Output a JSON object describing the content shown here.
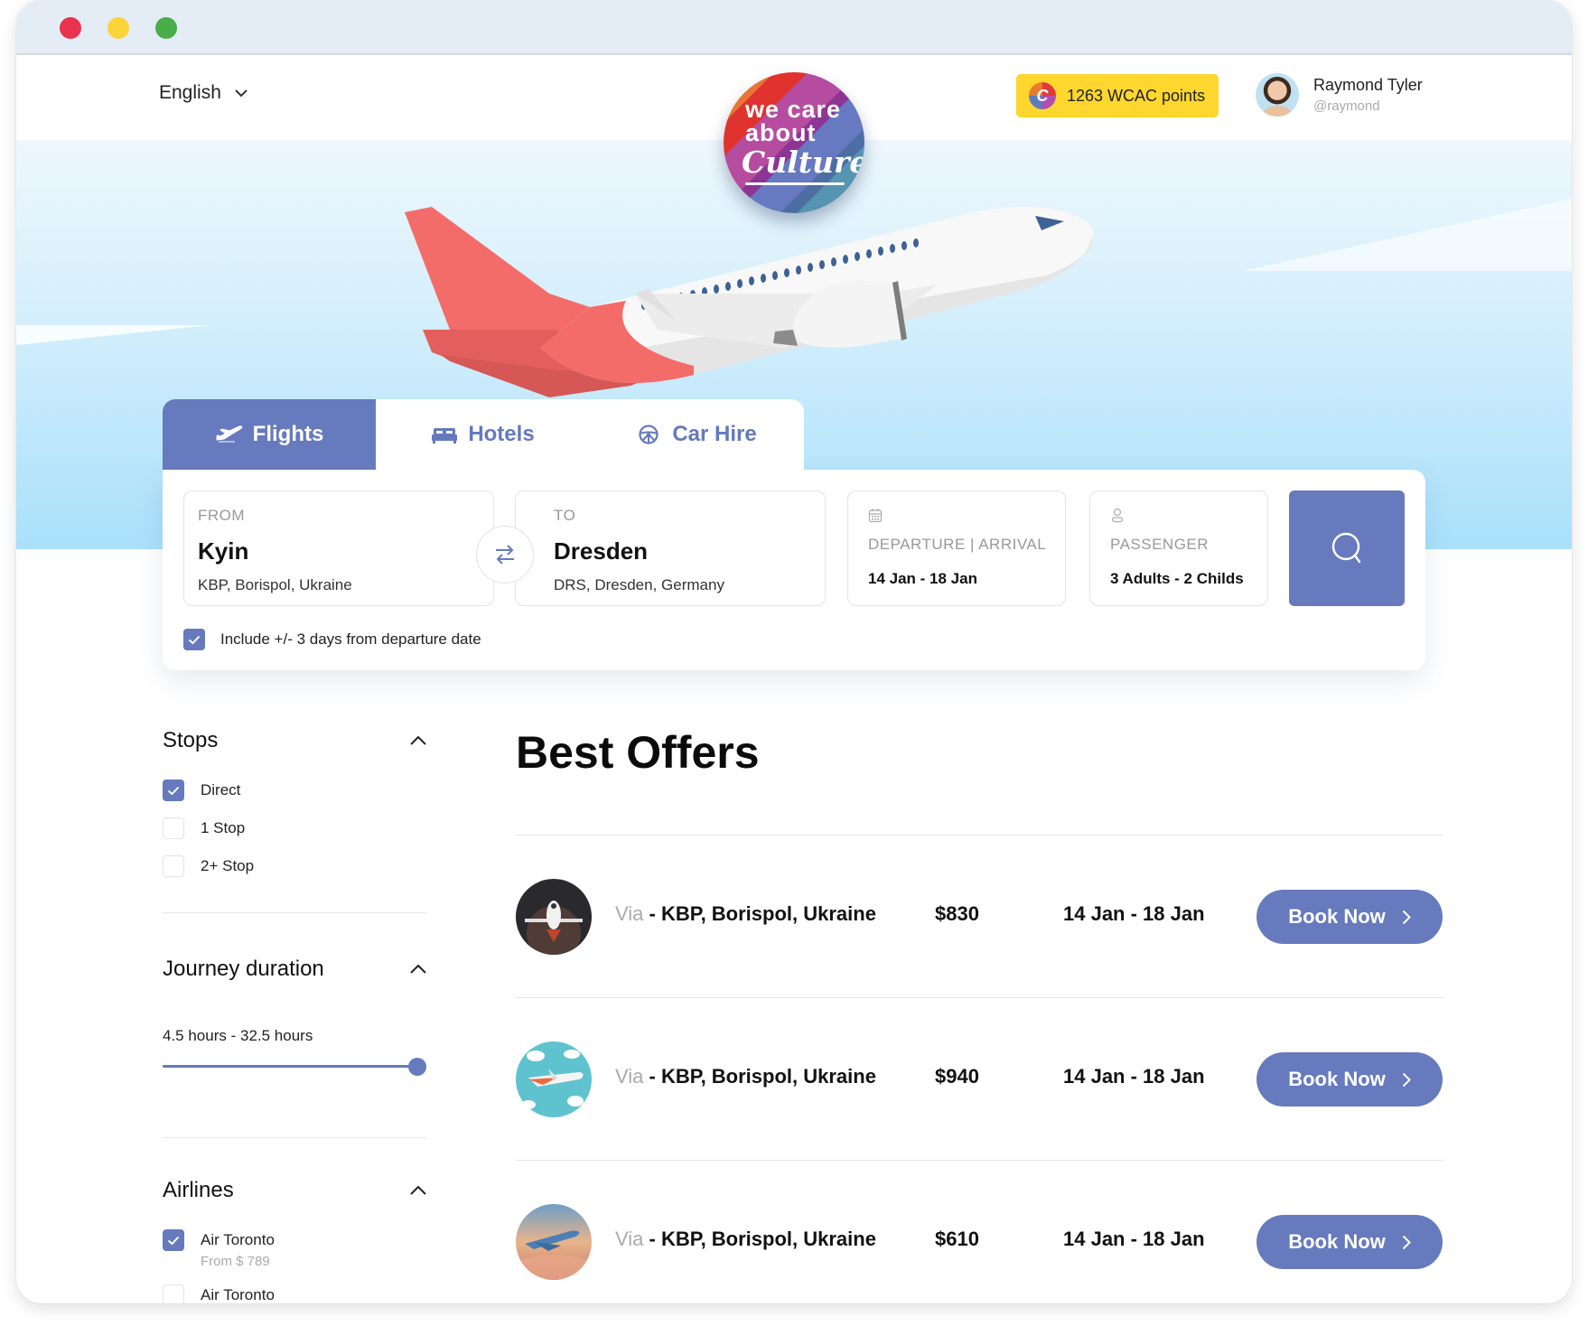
{
  "window": {
    "controls": [
      "close",
      "minimize",
      "maximize"
    ]
  },
  "header": {
    "language": "English",
    "points_label": "1263 WCAC points",
    "points_icon_letter": "C",
    "user": {
      "name": "Raymond Tyler",
      "handle": "@raymond"
    }
  },
  "logo": {
    "line1": "we care",
    "line2": "about",
    "line3": "Culture"
  },
  "tabs": [
    {
      "label": "Flights",
      "icon": "plane-icon",
      "active": true
    },
    {
      "label": "Hotels",
      "icon": "bed-icon",
      "active": false
    },
    {
      "label": "Car Hire",
      "icon": "steering-wheel-icon",
      "active": false
    }
  ],
  "search": {
    "from": {
      "label": "FROM",
      "city": "Kyin",
      "detail": "KBP, Borispol, Ukraine"
    },
    "to": {
      "label": "TO",
      "city": "Dresden",
      "detail": "DRS, Dresden, Germany"
    },
    "dates": {
      "label": "DEPARTURE  |  ARRIVAL",
      "value": "14 Jan  -  18 Jan"
    },
    "passenger": {
      "label": "PASSENGER",
      "value": "3 Adults - 2 Childs"
    },
    "include_flex": {
      "label": "Include +/- 3 days from departure date",
      "checked": true
    }
  },
  "filters": {
    "stops": {
      "title": "Stops",
      "options": [
        {
          "label": "Direct",
          "checked": true
        },
        {
          "label": "1 Stop",
          "checked": false
        },
        {
          "label": "2+ Stop",
          "checked": false
        }
      ]
    },
    "duration": {
      "title": "Journey duration",
      "range_label": "4.5 hours - 32.5 hours",
      "min_hours": 4.5,
      "max_hours": 32.5,
      "slider_fraction": 1.0
    },
    "airlines": {
      "title": "Airlines",
      "options": [
        {
          "label": "Air Toronto",
          "sub": "From $ 789",
          "checked": true
        },
        {
          "label": "Air Toronto",
          "sub": "",
          "checked": false
        }
      ]
    }
  },
  "offers": {
    "title": "Best Offers",
    "items": [
      {
        "via_prefix": "Via",
        "via": " - KBP, Borispol, Ukraine",
        "price": "$830",
        "dates": "14 Jan - 18 Jan",
        "button": "Book Now"
      },
      {
        "via_prefix": "Via",
        "via": " - KBP, Borispol, Ukraine",
        "price": "$940",
        "dates": "14 Jan - 18 Jan",
        "button": "Book Now"
      },
      {
        "via_prefix": "Via",
        "via": " - KBP, Borispol, Ukraine",
        "price": "$610",
        "dates": "14 Jan - 18 Jan",
        "button": "Book Now"
      }
    ]
  },
  "colors": {
    "accent": "#667abd",
    "points_badge": "#fdd62e",
    "close": "#e8334f",
    "minimize": "#fbd43a",
    "maximize": "#49ad4a"
  }
}
